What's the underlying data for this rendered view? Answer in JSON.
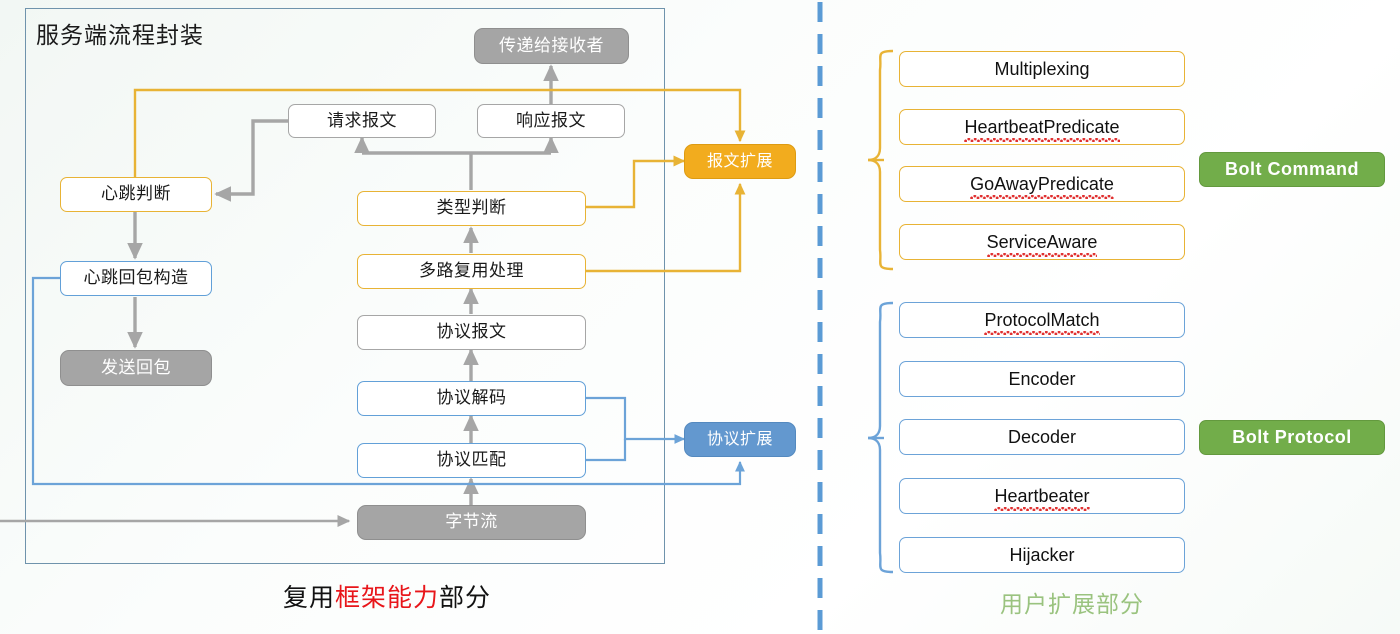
{
  "diagram": {
    "title": "服务端流程封装",
    "left_caption": {
      "pre": "复用",
      "highlight": "框架能力",
      "post": "部分"
    },
    "right_caption": "用户扩展部分",
    "colors": {
      "orange": "#f2ac1e",
      "orange_border": "#e8b335",
      "blue": "#6398cf",
      "blue_border": "#62a0d8",
      "gray_fill": "#a5a5a5",
      "gray_border": "#a6a6a6",
      "green": "#72ad4a",
      "divider_blue": "#5b9bd5",
      "caption_red": "#e8161a",
      "caption_green": "#9ac37f"
    }
  },
  "flow_nodes": {
    "deliver_to_receiver": "传递给接收者",
    "request_message": "请求报文",
    "response_message": "响应报文",
    "heartbeat_judge": "心跳判断",
    "type_judge": "类型判断",
    "heartbeat_reply_build": "心跳回包构造",
    "multiplex_handle": "多路复用处理",
    "send_reply": "发送回包",
    "protocol_message": "协议报文",
    "protocol_decode": "协议解码",
    "protocol_match": "协议匹配",
    "byte_stream": "字节流",
    "message_extension": "报文扩展",
    "protocol_extension": "协议扩展"
  },
  "extensions": {
    "command_group": {
      "badge": "Bolt Command",
      "items": [
        {
          "label": "Multiplexing",
          "misspelled": false
        },
        {
          "label": "HeartbeatPredicate",
          "misspelled": true
        },
        {
          "label": "GoAwayPredicate",
          "misspelled": true
        },
        {
          "label": "ServiceAware",
          "misspelled": true
        }
      ]
    },
    "protocol_group": {
      "badge": "Bolt Protocol",
      "items": [
        {
          "label": "ProtocolMatch",
          "misspelled": true
        },
        {
          "label": "Encoder",
          "misspelled": false
        },
        {
          "label": "Decoder",
          "misspelled": false
        },
        {
          "label": "Heartbeater",
          "misspelled": true
        },
        {
          "label": "Hijacker",
          "misspelled": false
        }
      ]
    }
  },
  "icons": {
    "divider": "vertical-dashed-divider-icon",
    "brace_top": "curly-brace-icon",
    "brace_bottom": "curly-brace-icon"
  }
}
